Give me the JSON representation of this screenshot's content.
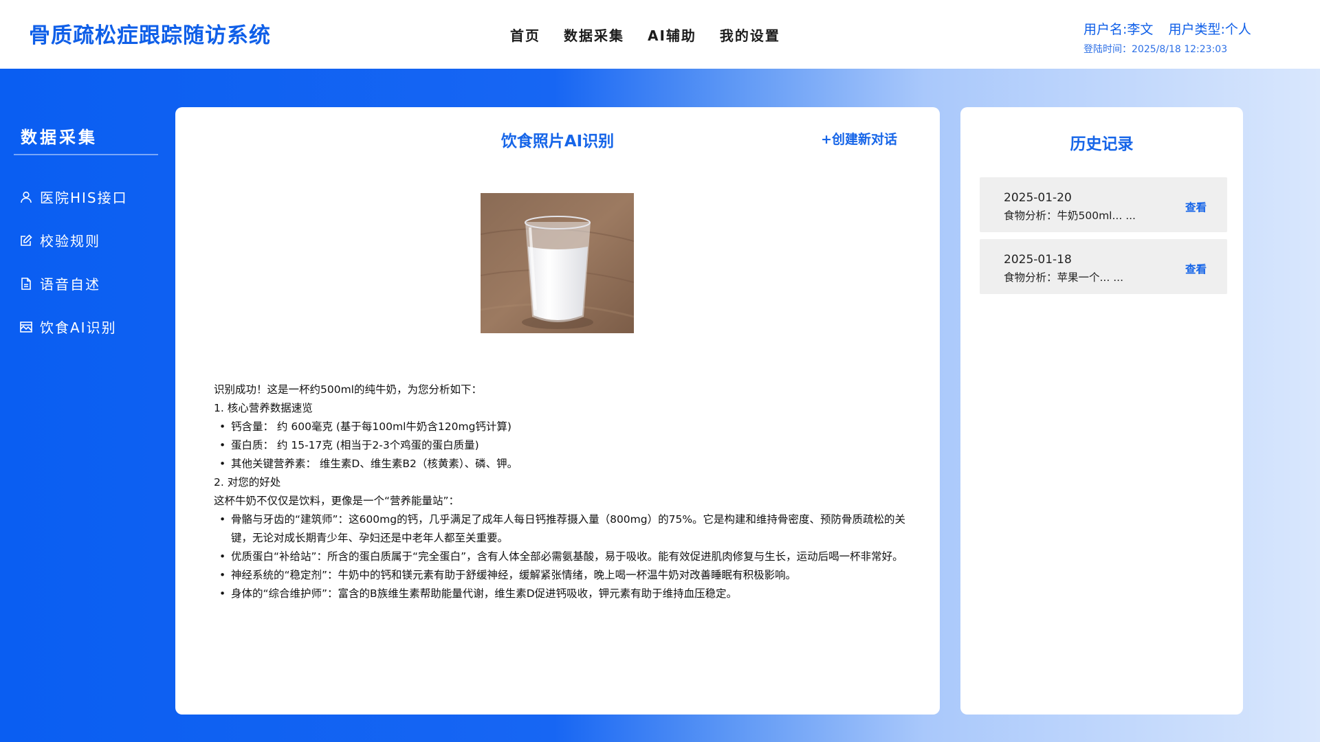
{
  "header": {
    "app_title": "骨质疏松症跟踪随访系统",
    "nav": [
      "首页",
      "数据采集",
      "AI辅助",
      "我的设置"
    ],
    "user_name": "用户名:李文",
    "user_type": "用户类型:个人",
    "login_time": "登陆时间：2025/8/18 12:23:03"
  },
  "sidebar": {
    "title": "数据采集",
    "items": [
      {
        "label": "医院HIS接口",
        "icon": "user-icon"
      },
      {
        "label": "校验规则",
        "icon": "edit-icon"
      },
      {
        "label": "语音自述",
        "icon": "document-icon"
      },
      {
        "label": "饮食AI识别",
        "icon": "image-icon"
      }
    ]
  },
  "main": {
    "title": "饮食照片AI识别",
    "new_chat": "+创建新对话",
    "photo": "milk-glass-photo",
    "result": [
      "识别成功！这是一杯约500ml的纯牛奶，为您分析如下：",
      "1. 核心营养数据速览",
      "钙含量： 约 600毫克 (基于每100ml牛奶含120mg钙计算)",
      "蛋白质： 约 15-17克 (相当于2-3个鸡蛋的蛋白质量)",
      "其他关键营养素： 维生素D、维生素B2（核黄素）、磷、钾。",
      "2. 对您的好处",
      "这杯牛奶不仅仅是饮料，更像是一个“营养能量站”：",
      "骨骼与牙齿的“建筑师”：这600mg的钙，几乎满足了成年人每日钙推荐摄入量（800mg）的75%。它是构建和维持骨密度、预防骨质疏松的关键，无论对成长期青少年、孕妇还是中老年人都至关重要。",
      "优质蛋白“补给站”：所含的蛋白质属于“完全蛋白”，含有人体全部必需氨基酸，易于吸收。能有效促进肌肉修复与生长，运动后喝一杯非常好。",
      "神经系统的“稳定剂”：牛奶中的钙和镁元素有助于舒缓神经，缓解紧张情绪，晚上喝一杯温牛奶对改善睡眠有积极影响。",
      "身体的“综合维护师”：富含的B族维生素帮助能量代谢，维生素D促进钙吸收，钾元素有助于维持血压稳定。"
    ]
  },
  "history": {
    "title": "历史记录",
    "items": [
      {
        "date": "2025-01-20",
        "desc": "食物分析：牛奶500ml... ...",
        "action": "查看"
      },
      {
        "date": "2025-01-18",
        "desc": "食物分析：苹果一个... ...",
        "action": "查看"
      }
    ]
  },
  "colors": {
    "brand": "#0f5fe8",
    "gradient_start": "#0a5ef2",
    "gradient_end": "#d9e7fd"
  }
}
